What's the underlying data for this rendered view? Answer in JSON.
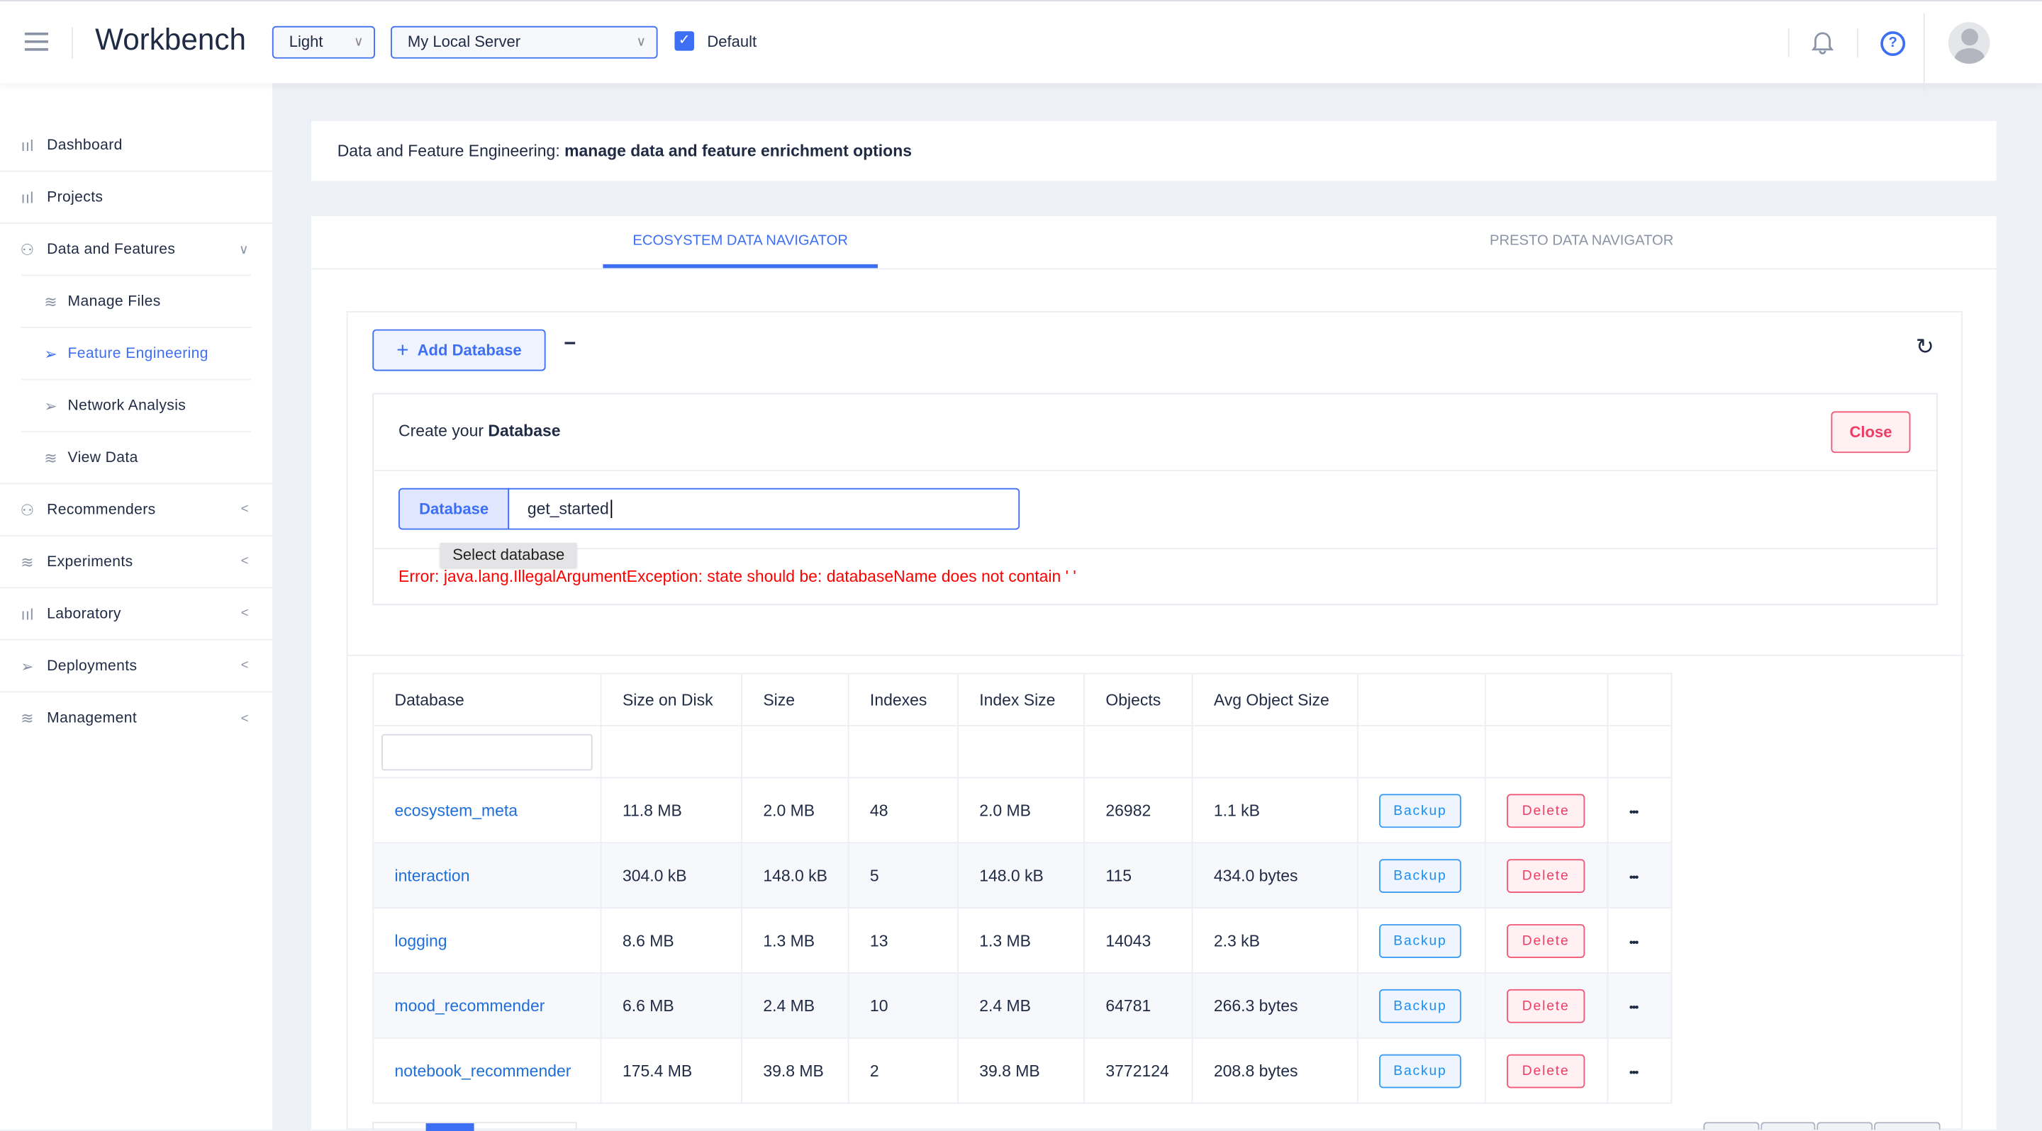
{
  "header": {
    "app_title": "Workbench",
    "theme_select": "Light",
    "server_select": "My Local Server",
    "default_checked": true,
    "default_label": "Default",
    "icons": [
      "menu-icon",
      "bell-icon",
      "help-icon",
      "avatar-icon"
    ]
  },
  "sidebar": {
    "items": [
      {
        "label": "Dashboard",
        "icon": "bar-chart-icon"
      },
      {
        "label": "Projects",
        "icon": "bar-chart-icon"
      },
      {
        "label": "Data and Features",
        "icon": "user-icon",
        "expanded": true
      },
      {
        "label": "Manage Files",
        "icon": "layers-icon",
        "sub": true
      },
      {
        "label": "Feature Engineering",
        "icon": "send-icon",
        "sub": true,
        "active": true
      },
      {
        "label": "Network Analysis",
        "icon": "send-icon",
        "sub": true
      },
      {
        "label": "View Data",
        "icon": "layers-icon",
        "sub": true
      },
      {
        "label": "Recommenders",
        "icon": "user-icon"
      },
      {
        "label": "Experiments",
        "icon": "layers-icon"
      },
      {
        "label": "Laboratory",
        "icon": "bar-chart-icon"
      },
      {
        "label": "Deployments",
        "icon": "send-icon"
      },
      {
        "label": "Management",
        "icon": "layers-icon"
      }
    ]
  },
  "page": {
    "title_prefix": "Data and Feature Engineering:",
    "title_bold": "manage data and feature enrichment options"
  },
  "tabs": [
    {
      "label": "ECOSYSTEM DATA NAVIGATOR",
      "active": true
    },
    {
      "label": "PRESTO DATA NAVIGATOR",
      "active": false
    }
  ],
  "toolbar": {
    "add_label": "Add Database",
    "collapse": "−"
  },
  "create": {
    "title_prefix": "Create your",
    "title_bold": "Database",
    "close_label": "Close",
    "input_label": "Database",
    "input_value": "get_started",
    "tooltip": "Select database",
    "error": "Error: java.lang.IllegalArgumentException: state should be: databaseName does not contain ' '"
  },
  "table": {
    "columns": [
      "Database",
      "Size on Disk",
      "Size",
      "Indexes",
      "Index Size",
      "Objects",
      "Avg Object Size",
      "",
      "",
      ""
    ],
    "filter_value": "",
    "backup_label": "Backup",
    "delete_label": "Delete",
    "more": "•••",
    "rows": [
      [
        "ecosystem_meta",
        "11.8 MB",
        "2.0 MB",
        "48",
        "2.0 MB",
        "26982",
        "1.1 kB"
      ],
      [
        "interaction",
        "304.0 kB",
        "148.0 kB",
        "5",
        "148.0 kB",
        "115",
        "434.0 bytes"
      ],
      [
        "logging",
        "8.6 MB",
        "1.3 MB",
        "13",
        "1.3 MB",
        "14043",
        "2.3 kB"
      ],
      [
        "mood_recommender",
        "6.6 MB",
        "2.4 MB",
        "10",
        "2.4 MB",
        "64781",
        "266.3 bytes"
      ],
      [
        "notebook_recommender",
        "175.4 MB",
        "39.8 MB",
        "2",
        "39.8 MB",
        "3772124",
        "208.8 bytes"
      ]
    ]
  },
  "colors": {
    "accent": "#3d6ff5",
    "error": "#ff0000",
    "danger": "#ee3d62",
    "link": "#1e6fd9"
  }
}
